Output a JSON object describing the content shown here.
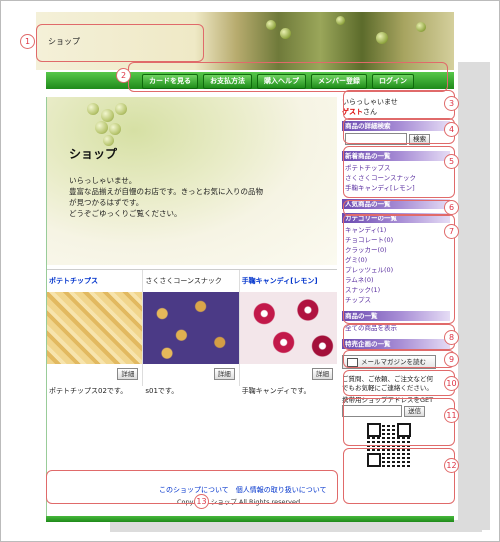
{
  "shop_title": "ショップ",
  "nav": [
    "カードを見る",
    "お支払方法",
    "購入ヘルプ",
    "メンバー登録",
    "ログイン"
  ],
  "hero": {
    "title": "ショップ",
    "lines": [
      "いらっしゃいませ。",
      "豊富な品揃えが自慢のお店です。きっとお気に入りの品物",
      "が見つかるはずです。",
      "どうぞごゆっくりご覧ください。"
    ]
  },
  "products": [
    {
      "name": "ポテトチップス",
      "detail": "詳細",
      "desc": "ポテトチップス02です。"
    },
    {
      "name": "さくさくコーンスナック",
      "detail": "詳細",
      "desc": "s01です。"
    },
    {
      "name": "手鞠キャンディ[レモン]",
      "detail": "詳細",
      "desc": "手鞠キャンディです。"
    }
  ],
  "footer": {
    "links": "このショップについて　個人情報の取り扱いについて",
    "copyright": "Copyright ショップ All Rights reserved."
  },
  "sidebar": {
    "welcome": "いらっしゃいませ",
    "guest": "ゲスト",
    "guest_suffix": "さん",
    "search_head": "商品の詳細検索",
    "search_btn": "検索",
    "new_head": "新着商品の一覧",
    "new_items": [
      "ポテトチップス",
      "さくさくコーンスナック",
      "手鞠キャンディ[レモン]"
    ],
    "popular_head": "人気商品の一覧",
    "category_head": "カテゴリーの一覧",
    "categories": [
      "キャンディ(1)",
      "チョコレート(0)",
      "クラッカー(0)",
      "グミ(0)",
      "プレッツェル(0)",
      "ラムネ(0)",
      "スナック(1)",
      "チップス"
    ],
    "all_head": "商品の一覧",
    "all_link": "全ての商品を表示",
    "special_head": "特売企画の一覧",
    "mail_btn": "メールマガジンを読む",
    "contact": [
      "ご質問、ご依頼、ご注文など何",
      "でもお気軽にご連絡ください。"
    ],
    "mobile_label": "携帯用ショップアドレスをGET",
    "mobile_btn": "送信"
  },
  "callouts": [
    "1",
    "2",
    "3",
    "4",
    "5",
    "6",
    "7",
    "8",
    "9",
    "10",
    "11",
    "12",
    "13"
  ]
}
